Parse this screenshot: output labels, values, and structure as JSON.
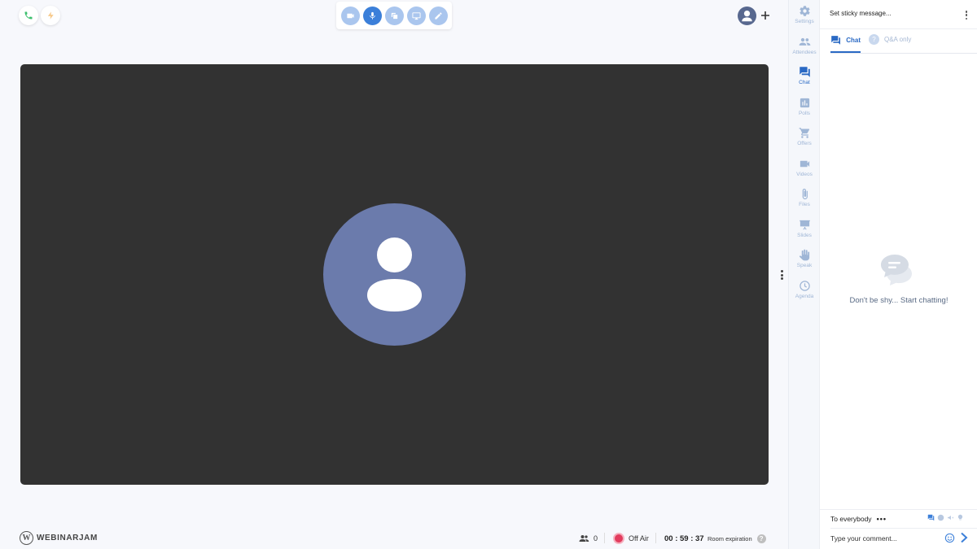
{
  "call_controls": [
    {
      "name": "phone-icon",
      "color": "#3dbf6e"
    },
    {
      "name": "lightning-icon",
      "color": "#f7c98a"
    }
  ],
  "toolbar": [
    {
      "name": "camera-icon",
      "active": false
    },
    {
      "name": "microphone-icon",
      "active": true
    },
    {
      "name": "share-screen-icon",
      "active": false
    },
    {
      "name": "monitor-icon",
      "active": false
    },
    {
      "name": "pencil-icon",
      "active": false
    }
  ],
  "nav": {
    "items": [
      {
        "label": "Settings",
        "icon": "gear-icon",
        "active": false
      },
      {
        "label": "Attendees",
        "icon": "people-icon",
        "active": false
      },
      {
        "label": "Chat",
        "icon": "chat-icon",
        "active": true
      },
      {
        "label": "Polls",
        "icon": "bar-chart-icon",
        "active": false
      },
      {
        "label": "Offers",
        "icon": "cart-icon",
        "active": false
      },
      {
        "label": "Videos",
        "icon": "video-icon",
        "active": false
      },
      {
        "label": "Files",
        "icon": "paperclip-icon",
        "active": false
      },
      {
        "label": "Slides",
        "icon": "presentation-icon",
        "active": false
      },
      {
        "label": "Speak",
        "icon": "hand-icon",
        "active": false
      },
      {
        "label": "Agenda",
        "icon": "clock-icon",
        "active": false
      }
    ]
  },
  "chat": {
    "sticky_placeholder": "Set sticky message...",
    "tab_chat": "Chat",
    "tab_qa": "Q&A only",
    "qa_icon_glyph": "?",
    "empty_message": "Don't be shy... Start chatting!",
    "recipient": "To everybody",
    "recipient_more": "•••",
    "comment_placeholder": "Type your comment..."
  },
  "footer": {
    "brand": "WEBINARJAM",
    "brand_mark": "W",
    "attendee_count": "0",
    "broadcast_status": "Off Air",
    "timer": "00 : 59 : 37",
    "room_expiration_label": "Room expiration",
    "help_glyph": "?"
  },
  "colors": {
    "accent": "#2a69c4",
    "stage_bg": "#323232",
    "avatar_bg": "#6b7bac",
    "off_air": "#e23c5e"
  }
}
